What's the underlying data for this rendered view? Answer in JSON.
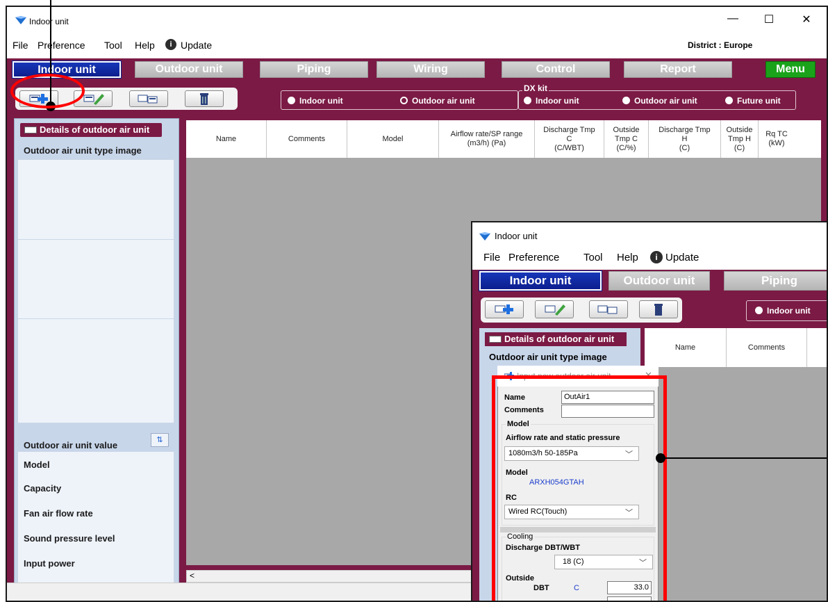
{
  "app": {
    "title": "Indoor unit",
    "window_controls": {
      "minimize": "—",
      "maximize": "☐",
      "close": "✕"
    },
    "menu": [
      "File",
      "Preference",
      "Tool",
      "Help"
    ],
    "update_label": "Update",
    "district": "District : Europe"
  },
  "tabs": [
    "Indoor unit",
    "Outdoor unit",
    "Piping",
    "Wiring",
    "Control",
    "Report",
    "Menu"
  ],
  "toolbar": {
    "radios": {
      "indoor": "Indoor unit",
      "outdoor_air": "Outdoor air unit",
      "dx_kit_label": "DX kit",
      "dx_indoor": "Indoor unit",
      "dx_outdoor_air": "Outdoor air unit",
      "future": "Future unit"
    }
  },
  "left_panel": {
    "header": "Details of outdoor air unit",
    "image_label": "Outdoor air unit type image",
    "value_label": "Outdoor air unit value",
    "values": [
      "Model",
      "Capacity",
      "Fan air flow rate",
      "Sound pressure level",
      "Input power"
    ]
  },
  "grid": {
    "columns": [
      "Name",
      "Comments",
      "Model",
      "Airflow rate/SP range\n(m3/h) (Pa)",
      "Discharge Tmp\nC\n(C/WBT)",
      "Outside\nTmp C\n(C/%)",
      "Discharge Tmp\nH\n(C)",
      "Outside\nTmp H\n(C)",
      "Rq TC\n(kW)"
    ]
  },
  "inset": {
    "title": "Indoor unit",
    "menu": [
      "File",
      "Preference",
      "Tool",
      "Help"
    ],
    "update_label": "Update",
    "tabs": [
      "Indoor unit",
      "Outdoor unit",
      "Piping"
    ],
    "radio_indoor": "Indoor unit",
    "panel_header": "Details of outdoor air unit",
    "image_label": "Outdoor air unit type image",
    "columns": [
      "Name",
      "Comments"
    ]
  },
  "dialog": {
    "title": "Input new outdoor air unit",
    "name_label": "Name",
    "name_value": "OutAir1",
    "comments_label": "Comments",
    "comments_value": "",
    "model_group": "Model",
    "airflow_label": "Airflow rate and static pressure",
    "airflow_value": "1080m3/h 50-185Pa",
    "model_label": "Model",
    "model_value": "ARXH054GTAH",
    "rc_label": "RC",
    "rc_value": "Wired RC(Touch)",
    "cooling_group": "Cooling",
    "discharge_label": "Discharge DBT/WBT",
    "discharge_value": "18 (C)",
    "outside_label": "Outside",
    "dbt_label": "DBT",
    "dbt_unit": "C",
    "dbt_value": "33.0"
  },
  "colors": {
    "frame": "#7b1a45",
    "active_tab": "#0d1f8e",
    "menu_tab": "#1aa31a",
    "highlight": "#ff0000",
    "panel": "#c8d6ea"
  }
}
